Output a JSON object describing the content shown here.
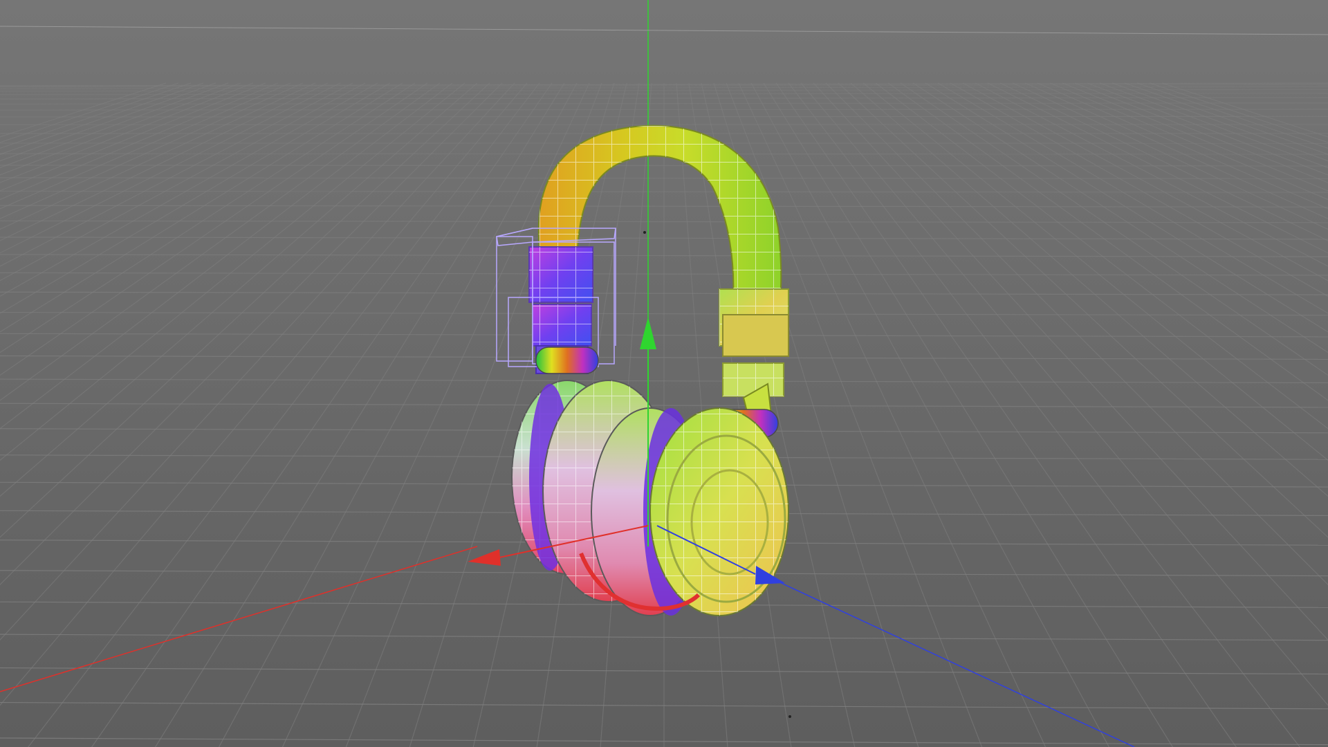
{
  "viewport": {
    "view_mode": "perspective",
    "grid_visible": true,
    "background_color": "#6b6b6b",
    "grid_color": "#7d7d7d",
    "axes": {
      "x_color": "#e0302a",
      "y_color": "#2fd52f",
      "z_color": "#3040e0"
    },
    "scene_object": {
      "name": "headphones",
      "texture": "uv-checker-rainbow",
      "selected_part": "left-slider-bounding-box"
    },
    "selection_box_color": "#b8a8ff"
  }
}
